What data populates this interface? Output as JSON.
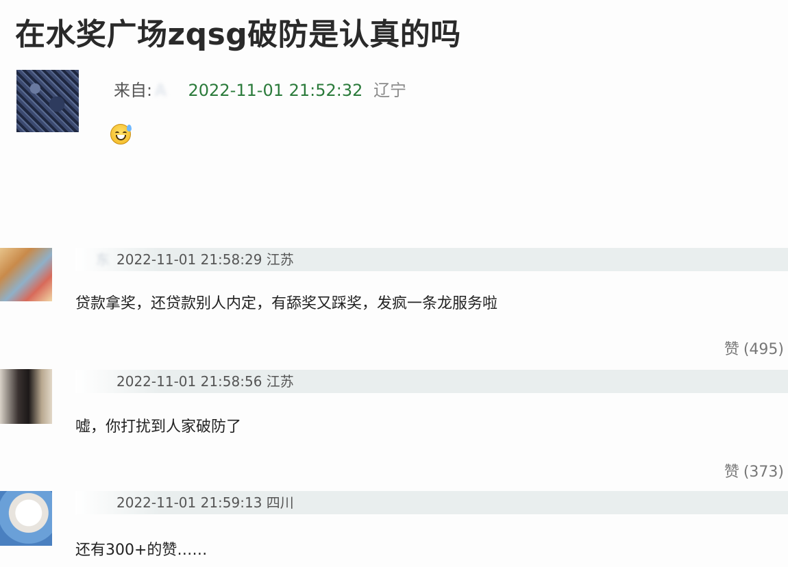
{
  "article": {
    "title": "在水奖广场zqsg破防是认真的吗"
  },
  "post": {
    "from_label": "来自:",
    "author": "A",
    "timestamp": "2022-11-01 21:52:32",
    "region": "辽宁",
    "emoji": "grinning-sweat-emoji"
  },
  "comments": [
    {
      "user": "东",
      "timestamp": "2022-11-01 21:58:29",
      "region": "江苏",
      "text": "贷款拿奖，还贷款别人内定，有舔奖又踩奖，发疯一条龙服务啦",
      "like_label": "赞",
      "like_count": "(495)"
    },
    {
      "user": "",
      "timestamp": "2022-11-01 21:58:56",
      "region": "江苏",
      "text": "嘘，你打扰到人家破防了",
      "like_label": "赞",
      "like_count": "(373)"
    },
    {
      "user": "",
      "timestamp": "2022-11-01 21:59:13",
      "region": "四川",
      "text": "还有300+的赞……"
    }
  ]
}
